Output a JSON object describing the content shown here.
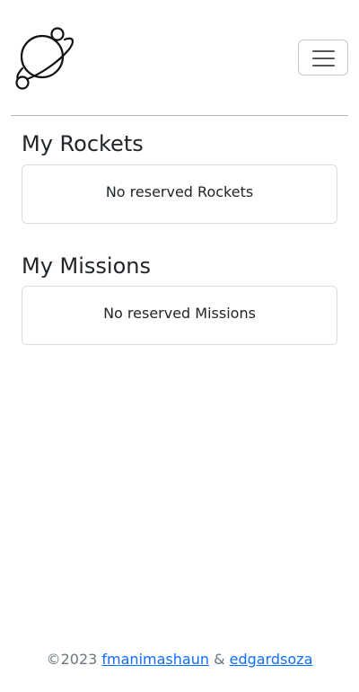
{
  "header": {
    "logo_icon": "planet-logo-icon",
    "menu_icon": "hamburger-menu-icon"
  },
  "profile": {
    "rockets": {
      "title": "My Rockets",
      "empty_message": "No reserved Rockets"
    },
    "missions": {
      "title": "My Missions",
      "empty_message": "No reserved Missions"
    }
  },
  "footer": {
    "copyright": "©2023",
    "author1": "fmanimashaun",
    "separator": "&",
    "author2": "edgardsoza"
  },
  "colors": {
    "link": "#0d6efd",
    "footer_text": "#6c757d",
    "divider": "#b5b5b5"
  }
}
